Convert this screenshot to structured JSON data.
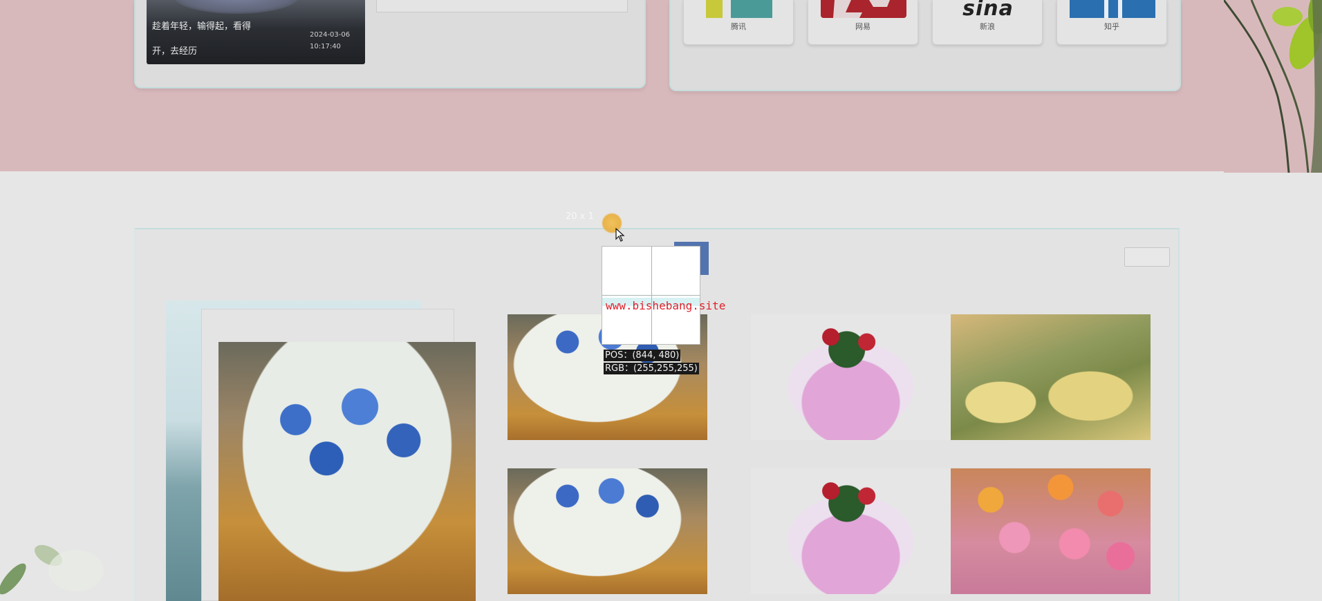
{
  "news": {
    "title_line1": "趁着年轻，输得起，看得",
    "title_line2": "开，去经历",
    "date_line1": "2024-03-06",
    "date_line2": "10:17:40"
  },
  "partners": [
    {
      "name": "腾讯",
      "logo": "tencent-logo"
    },
    {
      "name": "网易",
      "logo": "netease-logo"
    },
    {
      "name": "新浪",
      "logo_text": "sina"
    },
    {
      "name": "知乎",
      "logo": "zhihu-logo"
    }
  ],
  "color_picker": {
    "size_label": "20 x 1",
    "watermark": "www.bishebang.site",
    "pos_label": "POS：",
    "pos_value": "(844, 480)",
    "rgb_label": "RGB：",
    "rgb_value": "(255,255,255)"
  },
  "colors": {
    "top_band": "#d8b9bb",
    "panel_border": "#c6dcdc",
    "watermark": "#e0202a"
  }
}
